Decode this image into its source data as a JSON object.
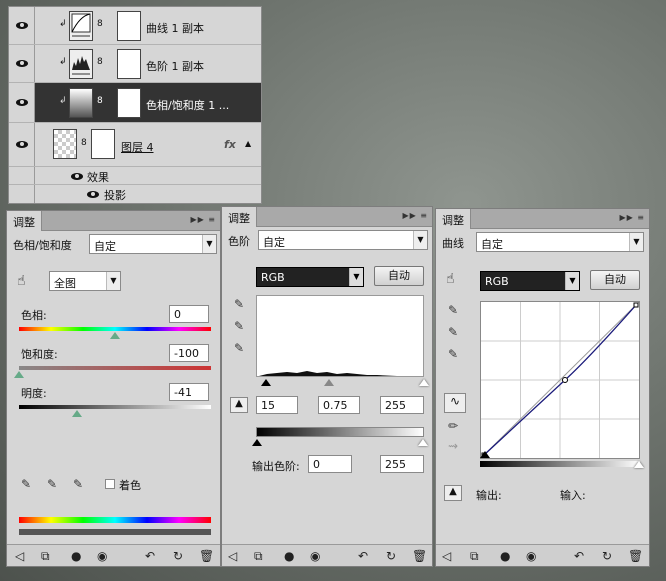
{
  "layers": {
    "rows": [
      {
        "name": "曲线 1 副本"
      },
      {
        "name": "色阶 1 副本"
      },
      {
        "name": "色相/饱和度 1 ..."
      },
      {
        "name": "图层 4",
        "fx": "fx"
      }
    ],
    "effects_label": "效果",
    "shadow_label": "投影"
  },
  "hs_panel": {
    "tab": "调整",
    "title": "色相/饱和度",
    "preset": "自定",
    "channel": "全图",
    "hue_label": "色相:",
    "hue_value": "0",
    "sat_label": "饱和度:",
    "sat_value": "-100",
    "light_label": "明度:",
    "light_value": "-41",
    "colorize_label": "着色",
    "hue_slider": 0.5,
    "sat_slider": 0.0,
    "light_slider": 0.3
  },
  "levels_panel": {
    "tab": "调整",
    "title": "色阶",
    "preset": "自定",
    "channel": "RGB",
    "auto": "自动",
    "in_black": "15",
    "in_mid": "0.75",
    "in_white": "255",
    "output_label": "输出色阶:",
    "out_black": "0",
    "out_white": "255"
  },
  "curves_panel": {
    "tab": "调整",
    "title": "曲线",
    "preset": "自定",
    "channel": "RGB",
    "auto": "自动",
    "output_label": "输出:",
    "input_label": "输入:"
  }
}
